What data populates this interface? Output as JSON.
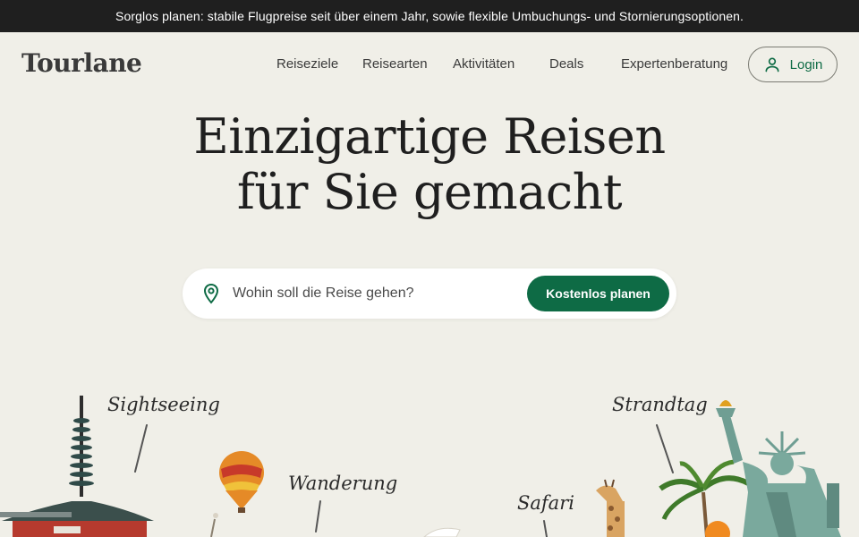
{
  "announcement": {
    "text": "Sorglos planen: stabile Flugpreise seit über einem Jahr, sowie flexible Umbuchungs- und Stornierungsoptionen."
  },
  "header": {
    "logo": "Tourlane",
    "nav": [
      {
        "label": "Reiseziele"
      },
      {
        "label": "Reisearten"
      },
      {
        "label": "Aktivitäten"
      },
      {
        "label": "Deals"
      },
      {
        "label": "Expertenberatung"
      }
    ],
    "login": {
      "label": "Login",
      "icon": "user-icon"
    }
  },
  "hero": {
    "title_line1": "Einzigartige Reisen",
    "title_line2": "für Sie gemacht"
  },
  "search": {
    "icon": "location-pin-icon",
    "placeholder": "Wohin soll die Reise gehen?",
    "value": "",
    "button_label": "Kostenlos planen"
  },
  "illustration_labels": {
    "sightseeing": "Sightseeing",
    "wanderung": "Wanderung",
    "safari": "Safari",
    "strandtag": "Strandtag"
  },
  "colors": {
    "background": "#f0efe8",
    "announcement_bg": "#1f1f1f",
    "brand_green": "#0e6b45",
    "text": "#2b2b2b"
  }
}
